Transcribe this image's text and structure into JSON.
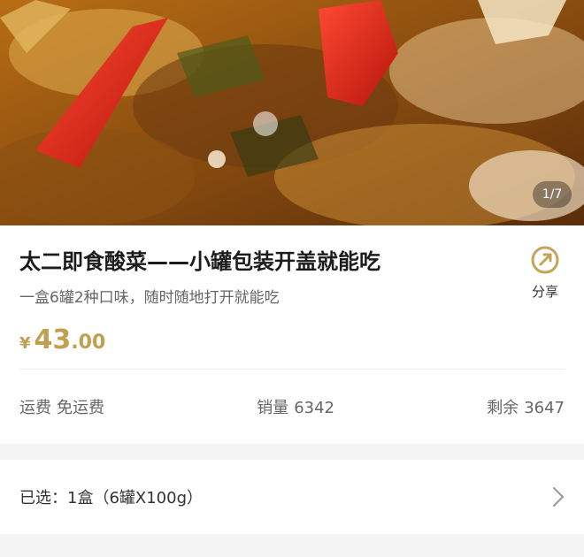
{
  "gallery": {
    "counter": "1/7",
    "image_alt": "pickled cabbage with red chili"
  },
  "product": {
    "title": "太二即食酸菜——小罐包装开盖就能吃",
    "subtitle": "一盒6罐2种口味，随时随地打开就能吃",
    "price": {
      "currency": "¥",
      "integer": "43",
      "decimal": ".00",
      "color": "#bf9f50"
    }
  },
  "share": {
    "label": "分享",
    "icon": "share-icon"
  },
  "stats": {
    "shipping": {
      "label": "运费",
      "value": "免运费"
    },
    "sales": {
      "label": "销量",
      "value": "6342"
    },
    "stock": {
      "label": "剩余",
      "value": "3647"
    }
  },
  "selection": {
    "label": "已选：",
    "value": "1盒（6罐X100g）",
    "icon": "chevron-right-icon"
  }
}
